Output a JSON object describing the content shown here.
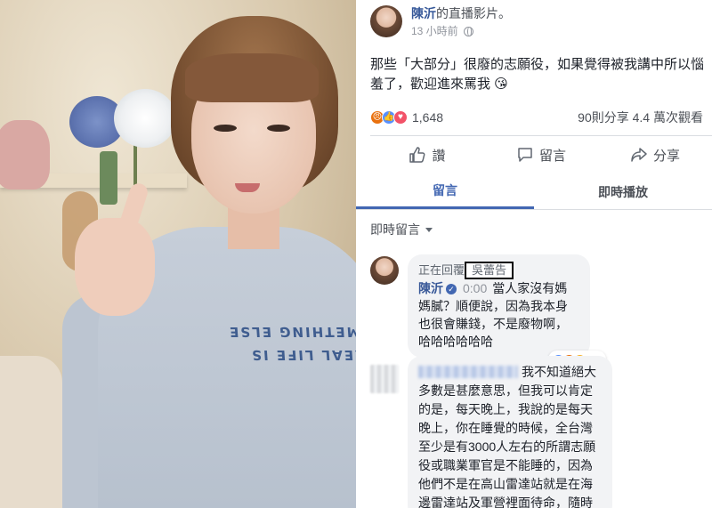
{
  "post": {
    "author": "陳沂",
    "title_suffix": "的直播影片。",
    "time": "13 小時前",
    "body": "那些「大部分」很廢的志願役，如果覺得被我講中所以惱羞了，歡迎進來罵我 😘",
    "reaction_count": "1,648",
    "stats": "90則分享  4.4 萬次觀看"
  },
  "video": {
    "shirt_text_line1": "REAL LIFE IS",
    "shirt_text_line2": "SOMETHING ELSE"
  },
  "actions": {
    "like": "讚",
    "comment": "留言",
    "share": "分享"
  },
  "tabs": {
    "comments": "留言",
    "replay": "即時播放"
  },
  "live_comments_label": "即時留言",
  "comment1": {
    "reply_prefix": "正在回覆",
    "reply_target": "吳蕾告",
    "name": "陳沂",
    "timestamp": "0:00",
    "text": "當人家沒有媽媽膩？順便說，因為我本身也很會賺錢，不是廢物啊，哈哈哈哈哈哈",
    "reaction_count": "16"
  },
  "comment2": {
    "text": "我不知道絕大多數是甚麼意思，但我可以肯定的是，每天晚上，我說的是每天晚上，你在睡覺的時候，全台灣至少是有3000人左右的所謂志願役或職業軍官是不能睡的，因為他們不是在高山雷達站就是在海邊雷達站及軍營裡面待命，隨時"
  },
  "colors": {
    "link": "#365899",
    "tab_active": "#4267b2",
    "bubble_bg": "#f2f3f5"
  },
  "icons": [
    "globe-icon",
    "like-icon",
    "comment-icon",
    "share-icon",
    "angry-icon",
    "love-icon",
    "haha-icon",
    "verified-icon"
  ]
}
